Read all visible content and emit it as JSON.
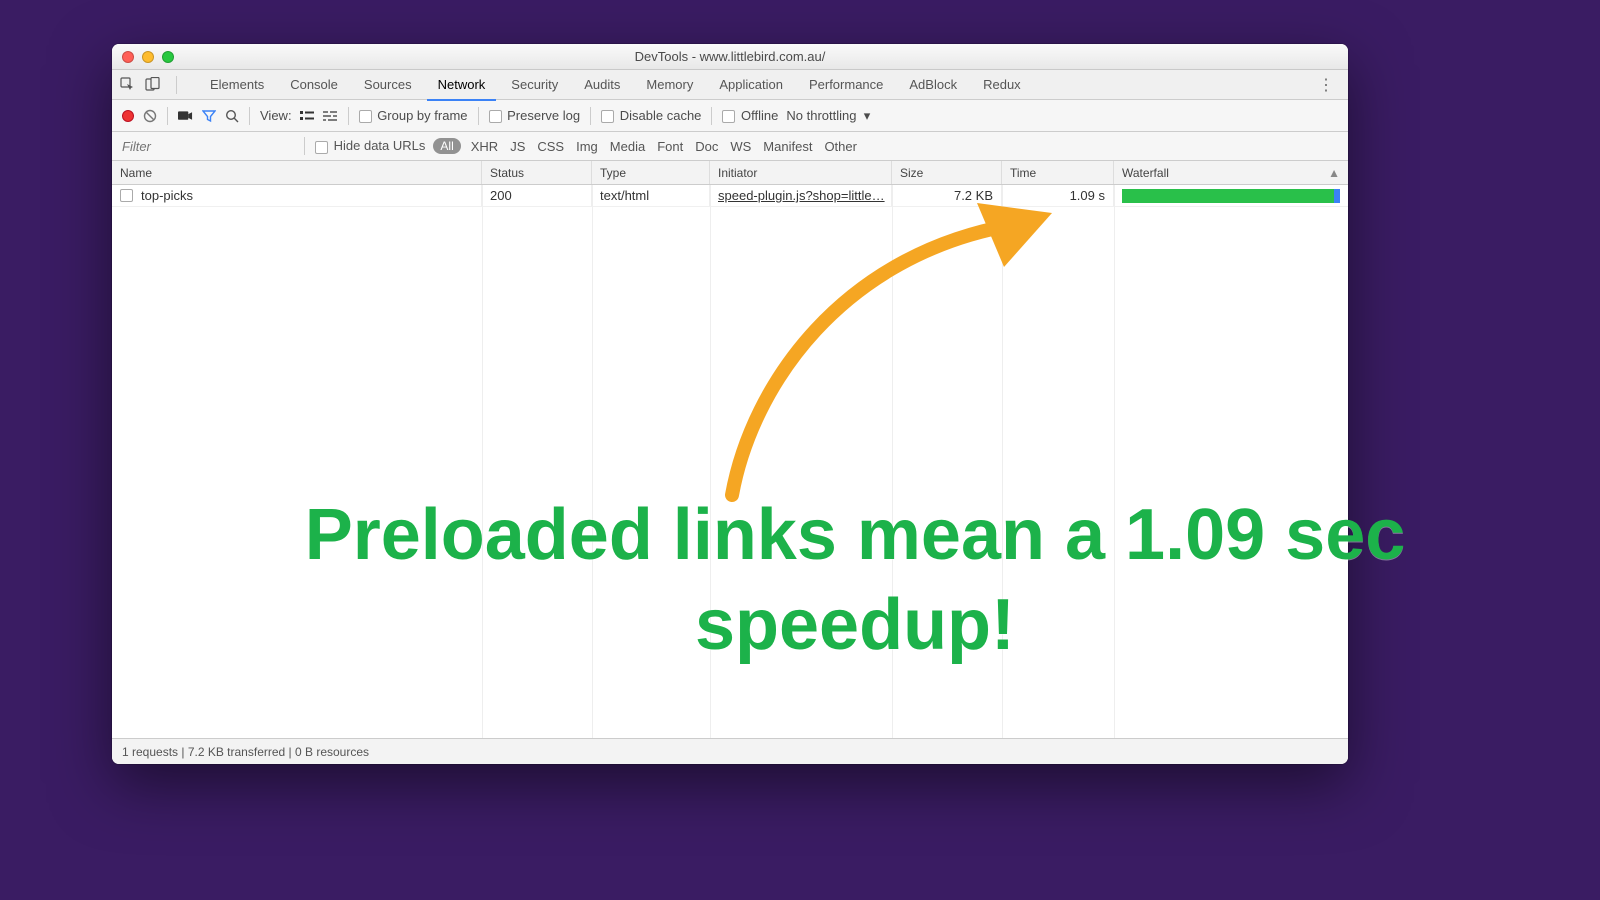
{
  "window": {
    "title": "DevTools - www.littlebird.com.au/"
  },
  "tabs": [
    "Elements",
    "Console",
    "Sources",
    "Network",
    "Security",
    "Audits",
    "Memory",
    "Application",
    "Performance",
    "AdBlock",
    "Redux"
  ],
  "activeTab": "Network",
  "toolbar": {
    "view_label": "View:",
    "group_by_frame": "Group by frame",
    "preserve_log": "Preserve log",
    "disable_cache": "Disable cache",
    "offline": "Offline",
    "throttling": "No throttling"
  },
  "filter": {
    "placeholder": "Filter",
    "hide_data_urls": "Hide data URLs",
    "all": "All",
    "types": [
      "XHR",
      "JS",
      "CSS",
      "Img",
      "Media",
      "Font",
      "Doc",
      "WS",
      "Manifest",
      "Other"
    ]
  },
  "columns": {
    "name": "Name",
    "status": "Status",
    "type": "Type",
    "initiator": "Initiator",
    "size": "Size",
    "time": "Time",
    "waterfall": "Waterfall"
  },
  "rows": [
    {
      "name": "top-picks",
      "status": "200",
      "type": "text/html",
      "initiator": "speed-plugin.js?shop=little…",
      "size": "7.2 KB",
      "time": "1.09 s"
    }
  ],
  "status": "1 requests | 7.2 KB transferred | 0 B resources",
  "annotation": "Preloaded links mean a 1.09 sec speedup!"
}
